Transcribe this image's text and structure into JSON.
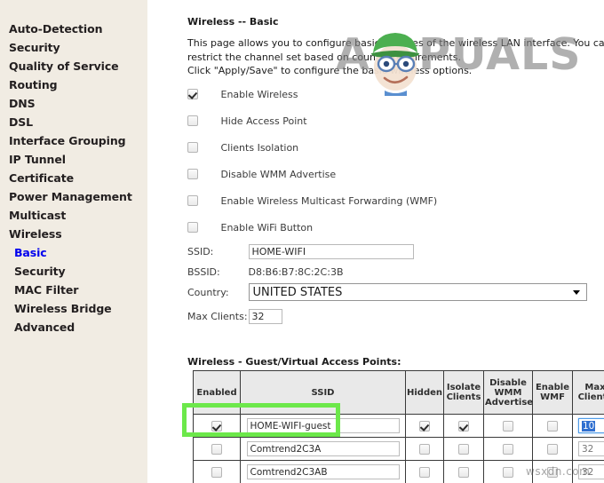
{
  "sidebar": {
    "items": [
      {
        "label": "Auto-Detection",
        "sub": false,
        "active": false
      },
      {
        "label": "Security",
        "sub": false,
        "active": false
      },
      {
        "label": "Quality of Service",
        "sub": false,
        "active": false
      },
      {
        "label": "Routing",
        "sub": false,
        "active": false
      },
      {
        "label": "DNS",
        "sub": false,
        "active": false
      },
      {
        "label": "DSL",
        "sub": false,
        "active": false
      },
      {
        "label": "Interface Grouping",
        "sub": false,
        "active": false
      },
      {
        "label": "IP Tunnel",
        "sub": false,
        "active": false
      },
      {
        "label": "Certificate",
        "sub": false,
        "active": false
      },
      {
        "label": "Power Management",
        "sub": false,
        "active": false
      },
      {
        "label": "Multicast",
        "sub": false,
        "active": false
      },
      {
        "label": "Wireless",
        "sub": false,
        "active": false
      },
      {
        "label": "Basic",
        "sub": true,
        "active": true
      },
      {
        "label": "Security",
        "sub": true,
        "active": false
      },
      {
        "label": "MAC Filter",
        "sub": true,
        "active": false
      },
      {
        "label": "Wireless Bridge",
        "sub": true,
        "active": false
      },
      {
        "label": "Advanced",
        "sub": true,
        "active": false
      }
    ]
  },
  "main": {
    "title": "Wireless -- Basic",
    "intro_lines": [
      "This page allows you to configure basic features of the wireless LAN interface. You can enable or disable t",
      "restrict the channel set based on country requirements.",
      "Click \"Apply/Save\" to configure the basic wireless options."
    ],
    "checkboxes": [
      {
        "label": "Enable Wireless",
        "checked": true
      },
      {
        "label": "Hide Access Point",
        "checked": false
      },
      {
        "label": "Clients Isolation",
        "checked": false
      },
      {
        "label": "Disable WMM Advertise",
        "checked": false
      },
      {
        "label": "Enable Wireless Multicast Forwarding (WMF)",
        "checked": false
      },
      {
        "label": "Enable WiFi Button",
        "checked": false
      }
    ],
    "fields": {
      "ssid_label": "SSID:",
      "ssid_value": "HOME-WIFI",
      "bssid_label": "BSSID:",
      "bssid_value": "D8:B6:B7:8C:2C:3B",
      "country_label": "Country:",
      "country_value": "UNITED STATES",
      "max_clients_label": "Max Clients:",
      "max_clients_value": "32"
    },
    "guest_section_title": "Wireless - Guest/Virtual Access Points:",
    "guest_table": {
      "headers": [
        "Enabled",
        "SSID",
        "Hidden",
        "Isolate Clients",
        "Disable WMM Advertise",
        "Enable WMF",
        "Max Clients"
      ],
      "rows": [
        {
          "enabled": true,
          "ssid": "HOME-WIFI-guest",
          "hidden": true,
          "isolate": true,
          "wmm": false,
          "wmf": false,
          "max_clients": "10",
          "max_clients_focused": true
        },
        {
          "enabled": false,
          "ssid": "Comtrend2C3A",
          "hidden": false,
          "isolate": false,
          "wmm": false,
          "wmf": false,
          "max_clients": "32",
          "max_clients_focused": false
        },
        {
          "enabled": false,
          "ssid": "Comtrend2C3AB",
          "hidden": false,
          "isolate": false,
          "wmm": false,
          "wmf": false,
          "max_clients": "32",
          "max_clients_focused": false
        }
      ]
    }
  },
  "watermarks": {
    "brand_prefix": "A",
    "brand_suffix": "PUALS",
    "corner": "wsxdn.com"
  },
  "colors": {
    "sidebar_bg": "#f1ece3",
    "active_link": "#0000ee",
    "annotation_green": "#6ce84a",
    "table_header_bg": "#e9e9e9",
    "focus_blue": "#2f6fd0"
  }
}
